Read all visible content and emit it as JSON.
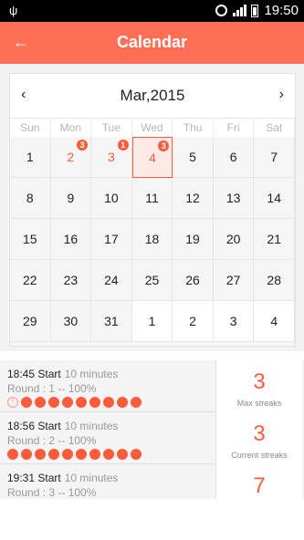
{
  "status_bar": {
    "time": "19:50"
  },
  "header": {
    "title": "Calendar",
    "back_icon": "←"
  },
  "calendar": {
    "month_label": "Mar,2015",
    "prev_icon": "‹",
    "next_icon": "›",
    "weekdays": [
      "Sun",
      "Mon",
      "Tue",
      "Wed",
      "Thu",
      "Fri",
      "Sat"
    ],
    "days": [
      {
        "label": "1"
      },
      {
        "label": "2",
        "badge": "3"
      },
      {
        "label": "3",
        "badge": "1"
      },
      {
        "label": "4",
        "badge": "3"
      },
      {
        "label": "5"
      },
      {
        "label": "6"
      },
      {
        "label": "7"
      },
      {
        "label": "8"
      },
      {
        "label": "9"
      },
      {
        "label": "10"
      },
      {
        "label": "11"
      },
      {
        "label": "12"
      },
      {
        "label": "13"
      },
      {
        "label": "14"
      },
      {
        "label": "15"
      },
      {
        "label": "16"
      },
      {
        "label": "17"
      },
      {
        "label": "18"
      },
      {
        "label": "19"
      },
      {
        "label": "20"
      },
      {
        "label": "21"
      },
      {
        "label": "22"
      },
      {
        "label": "23"
      },
      {
        "label": "24"
      },
      {
        "label": "25"
      },
      {
        "label": "26"
      },
      {
        "label": "27"
      },
      {
        "label": "28"
      },
      {
        "label": "29"
      },
      {
        "label": "30"
      },
      {
        "label": "31"
      },
      {
        "label": "1"
      },
      {
        "label": "2"
      },
      {
        "label": "3"
      },
      {
        "label": "4"
      }
    ],
    "accent_color": "#fe5a3c"
  },
  "sessions": [
    {
      "start": "18:45 Start",
      "duration": "10 minutes",
      "round": "Round : 1 -- 100%"
    },
    {
      "start": "18:56 Start",
      "duration": "10 minutes",
      "round": "Round : 2 -- 100%"
    },
    {
      "start": "19:31 Start",
      "duration": "10 minutes",
      "round": "Round : 3 -- 100%"
    }
  ],
  "stats": [
    {
      "value": "3",
      "label": "Max streaks"
    },
    {
      "value": "3",
      "label": "Current streaks"
    },
    {
      "value": "7",
      "label": ""
    }
  ]
}
